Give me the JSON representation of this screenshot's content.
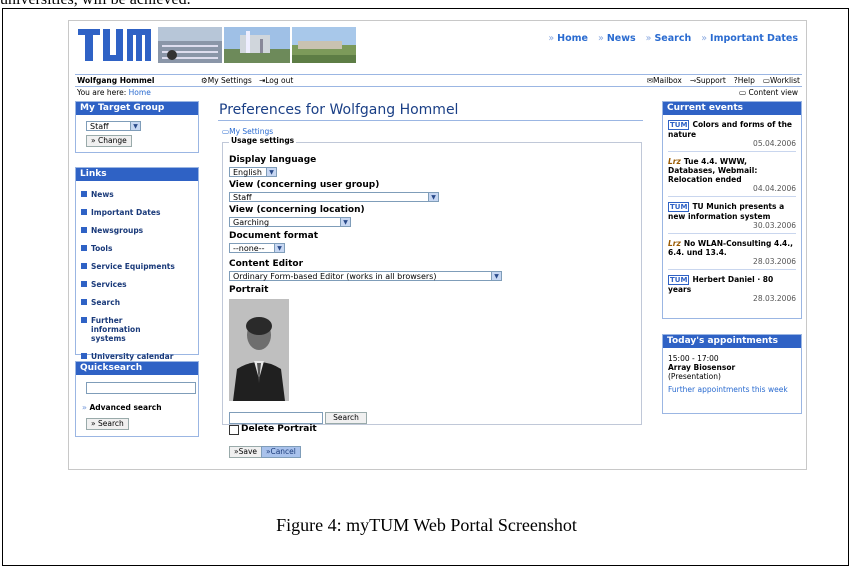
{
  "doc": {
    "top_text": "universities, will be achieved.",
    "caption": "Figure 4: myTUM Web Portal Screenshot"
  },
  "header": {
    "logo": "TUM",
    "nav": [
      "Home",
      "News",
      "Search",
      "Important Dates"
    ]
  },
  "userbar": {
    "user": "Wolfgang Hommel",
    "my_settings": "My Settings",
    "logout": "Log out",
    "mailbox": "Mailbox",
    "support": "Support",
    "help": "Help",
    "worklist": "Worklist"
  },
  "crumb": {
    "prefix": "You are here:",
    "home": "Home",
    "content_view": "Content view"
  },
  "target_group": {
    "title": "My Target Group",
    "selected": "Staff",
    "change": "Change"
  },
  "links": {
    "title": "Links",
    "items": [
      "News",
      "Important Dates",
      "Newsgroups",
      "Tools",
      "Service Equipments",
      "Services",
      "Search",
      "Further information systems",
      "University calendar"
    ]
  },
  "quicksearch": {
    "title": "Quicksearch",
    "advanced": "Advanced search",
    "search": "Search"
  },
  "main": {
    "title": "Preferences for Wolfgang Hommel",
    "my_settings": "My Settings",
    "legend": "Usage settings",
    "display_language": {
      "label": "Display language",
      "value": "English"
    },
    "view_group": {
      "label": "View (concerning user group)",
      "value": "Staff"
    },
    "view_location": {
      "label": "View (concerning location)",
      "value": "Garching"
    },
    "doc_format": {
      "label": "Document format",
      "value": "--none--"
    },
    "content_editor": {
      "label": "Content Editor",
      "value": "Ordinary Form-based Editor (works in all browsers)"
    },
    "portrait": "Portrait",
    "search_btn": "Search",
    "delete_portrait": "Delete Portrait",
    "save": "Save",
    "cancel": "Cancel"
  },
  "events": {
    "title": "Current events",
    "items": [
      {
        "text": "Colors and forms of the nature",
        "date": "05.04.2006"
      },
      {
        "text": "Tue 4.4. WWW, Databases, Webmail: Relocation ended",
        "date": "04.04.2006"
      },
      {
        "text": "TU Munich presents a new information system",
        "date": "30.03.2006"
      },
      {
        "text": "No WLAN-Consulting 4.4., 6.4. und 13.4.",
        "date": "28.03.2006"
      },
      {
        "text": "Herbert Daniel · 80 years",
        "date": "28.03.2006"
      }
    ]
  },
  "appointments": {
    "title": "Today's appointments",
    "time": "15:00 - 17:00",
    "name": "Array Biosensor",
    "type": "(Presentation)",
    "more": "Further appointments this week"
  }
}
